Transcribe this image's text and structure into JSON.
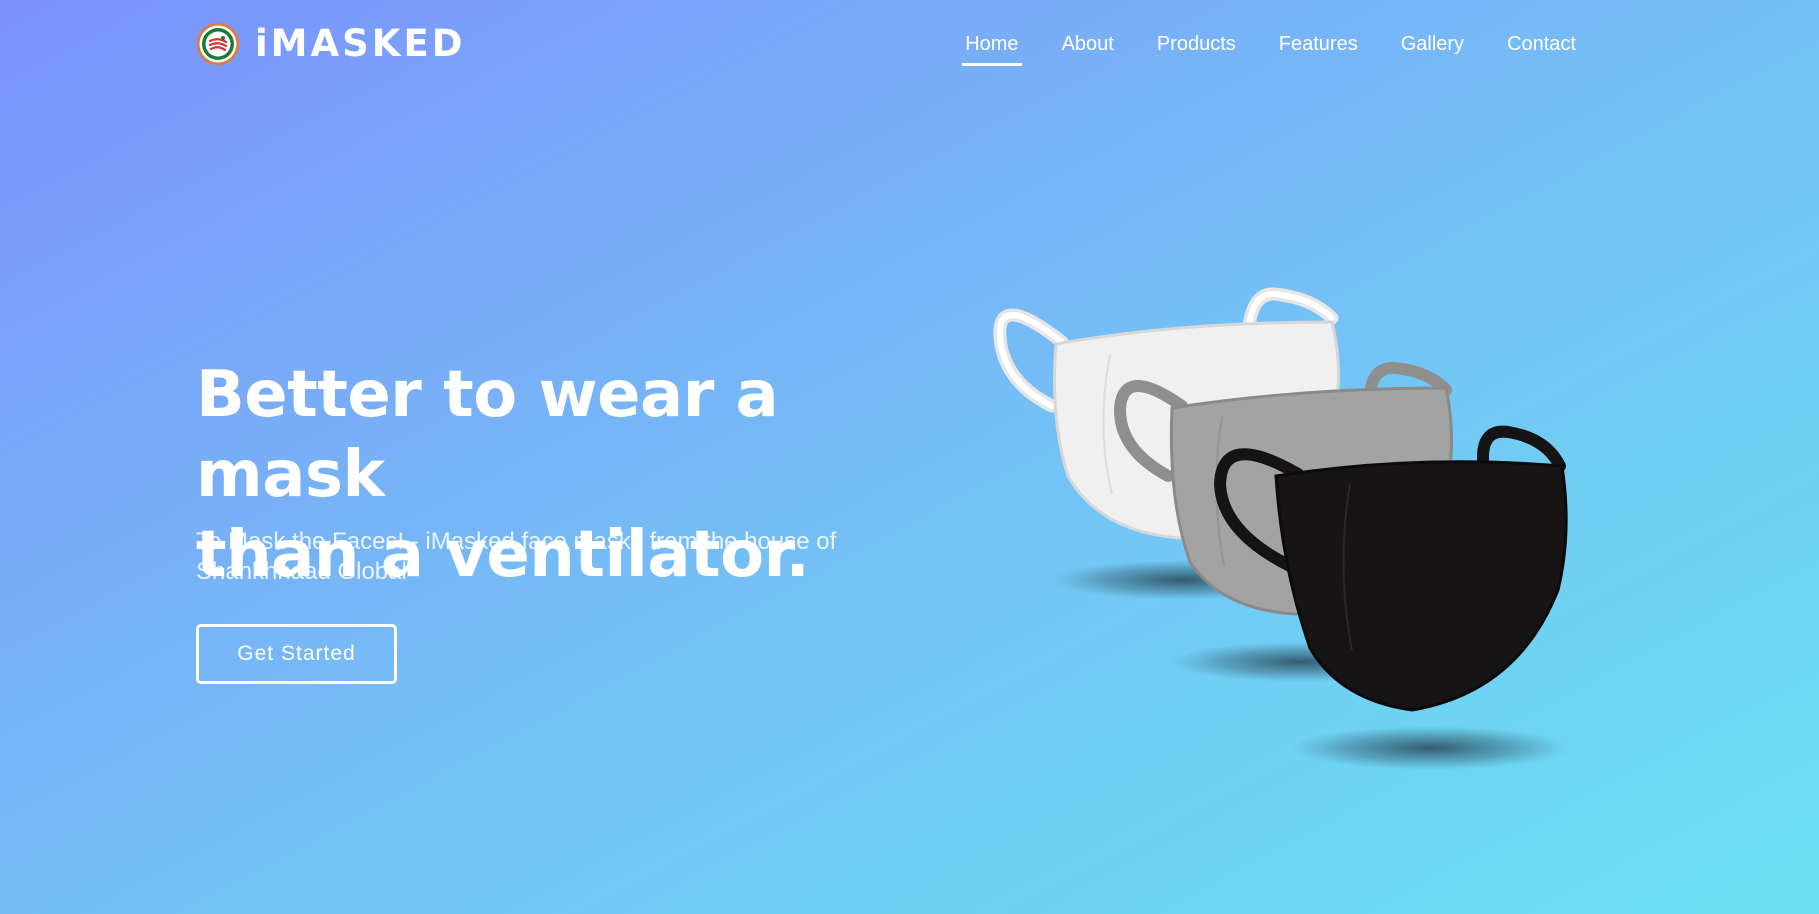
{
  "brand": {
    "name": "iMASKED",
    "logo_icon": "shankhnaad-badge-icon",
    "colors": {
      "ring_orange": "#e8782f",
      "ring_green": "#1a7a3a",
      "mark_red": "#d8332f"
    }
  },
  "nav": {
    "items": [
      {
        "label": "Home",
        "active": true
      },
      {
        "label": "About",
        "active": false
      },
      {
        "label": "Products",
        "active": false
      },
      {
        "label": "Features",
        "active": false
      },
      {
        "label": "Gallery",
        "active": false
      },
      {
        "label": "Contact",
        "active": false
      }
    ]
  },
  "hero": {
    "title_line1": "Better to wear a mask",
    "title_line2": "than a ventilator.",
    "subtitle": "To Mask the Faces! - iMasked face masks from the house of Shankhnaad Global",
    "cta_label": "Get Started",
    "image": {
      "subject": "three face masks",
      "mask_colors": [
        "#f2f2f2",
        "#9c9c9c",
        "#141212"
      ]
    }
  },
  "theme": {
    "gradient_start": "#7b91fd",
    "gradient_end": "#6be1f1",
    "text_color": "#ffffff"
  }
}
